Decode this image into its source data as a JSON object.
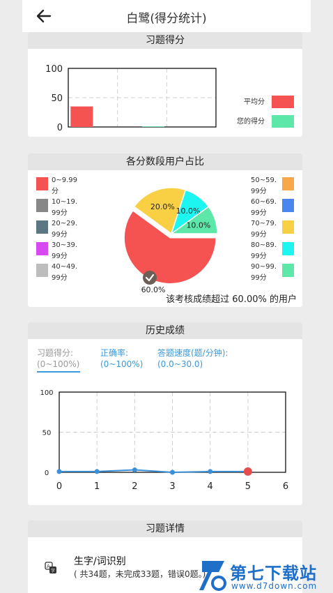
{
  "header": {
    "title": "白鹭(得分统计)"
  },
  "score_card": {
    "title": "习题得分",
    "legend": [
      {
        "label": "平均分",
        "color": "#f55252"
      },
      {
        "label": "您的得分",
        "color": "#5de7a9"
      }
    ]
  },
  "distribution_card": {
    "title": "各分数段用户占比",
    "left_legend": [
      {
        "l1": "0~9.99",
        "l2": "分",
        "color": "#f55252"
      },
      {
        "l1": "10~19.",
        "l2": "99分",
        "color": "#888888"
      },
      {
        "l1": "20~29.",
        "l2": "99分",
        "color": "#5c7682"
      },
      {
        "l1": "30~39.",
        "l2": "99分",
        "color": "#d74af0"
      },
      {
        "l1": "40~49.",
        "l2": "99分",
        "color": "#bdbdbd"
      }
    ],
    "right_legend": [
      {
        "l1": "50~59.",
        "l2": "99分",
        "color": "#f8a74a"
      },
      {
        "l1": "60~69.",
        "l2": "99分",
        "color": "#4a86f0"
      },
      {
        "l1": "70~79.",
        "l2": "99分",
        "color": "#f9d043"
      },
      {
        "l1": "80~89.",
        "l2": "99分",
        "color": "#1cf5f0"
      },
      {
        "l1": "90~99.",
        "l2": "99分",
        "color": "#5de7a9"
      }
    ],
    "summary": "该考核成绩超过 60.00% 的用户"
  },
  "history_card": {
    "title": "历史成绩",
    "tabs": [
      {
        "l1": "习题得分:",
        "l2": "(0~100%)"
      },
      {
        "l1": "正确率:",
        "l2": "(0~100%)"
      },
      {
        "l1": "答题速度(题/分钟):",
        "l2": "(0.0~30.0)"
      }
    ]
  },
  "detail_card": {
    "title": "习题详情",
    "item_title": "生字/词识别",
    "item_desc": "( 共34题，未完成33题，错误0题。)"
  },
  "watermark": {
    "brand": "第七下载站",
    "url": "www.d7down.com"
  },
  "chart_data": [
    {
      "type": "bar",
      "title": "习题得分",
      "categories": [
        "",
        "",
        ""
      ],
      "series": [
        {
          "name": "平均分",
          "values": [
            35,
            0,
            0
          ]
        },
        {
          "name": "您的得分",
          "values": [
            0,
            1,
            0
          ]
        }
      ],
      "ylim": [
        0,
        100
      ],
      "yticks": [
        0,
        50,
        100
      ],
      "grid": true,
      "legend": "right"
    },
    {
      "type": "pie",
      "title": "各分数段用户占比",
      "slices": [
        {
          "label": "0~9.99分",
          "value": 60.0,
          "label_text": "60.0%"
        },
        {
          "label": "70~79.99分",
          "value": 20.0,
          "label_text": "20.0%"
        },
        {
          "label": "80~89.99分",
          "value": 10.0,
          "label_text": "10.0%"
        },
        {
          "label": "90~99.99分",
          "value": 10.0,
          "label_text": "10.0%"
        }
      ],
      "legend": "left-and-right"
    },
    {
      "type": "line",
      "title": "历史成绩",
      "x": [
        0,
        1,
        2,
        3,
        4,
        5
      ],
      "series": [
        {
          "name": "习题得分",
          "values": [
            1,
            1,
            3,
            0,
            1,
            1
          ]
        }
      ],
      "xlim": [
        0,
        6
      ],
      "xticks": [
        0,
        1,
        2,
        3,
        4,
        5,
        6
      ],
      "ylim": [
        0,
        100
      ],
      "yticks": [
        0,
        50,
        100
      ],
      "highlight_index": 5,
      "grid": true
    }
  ]
}
